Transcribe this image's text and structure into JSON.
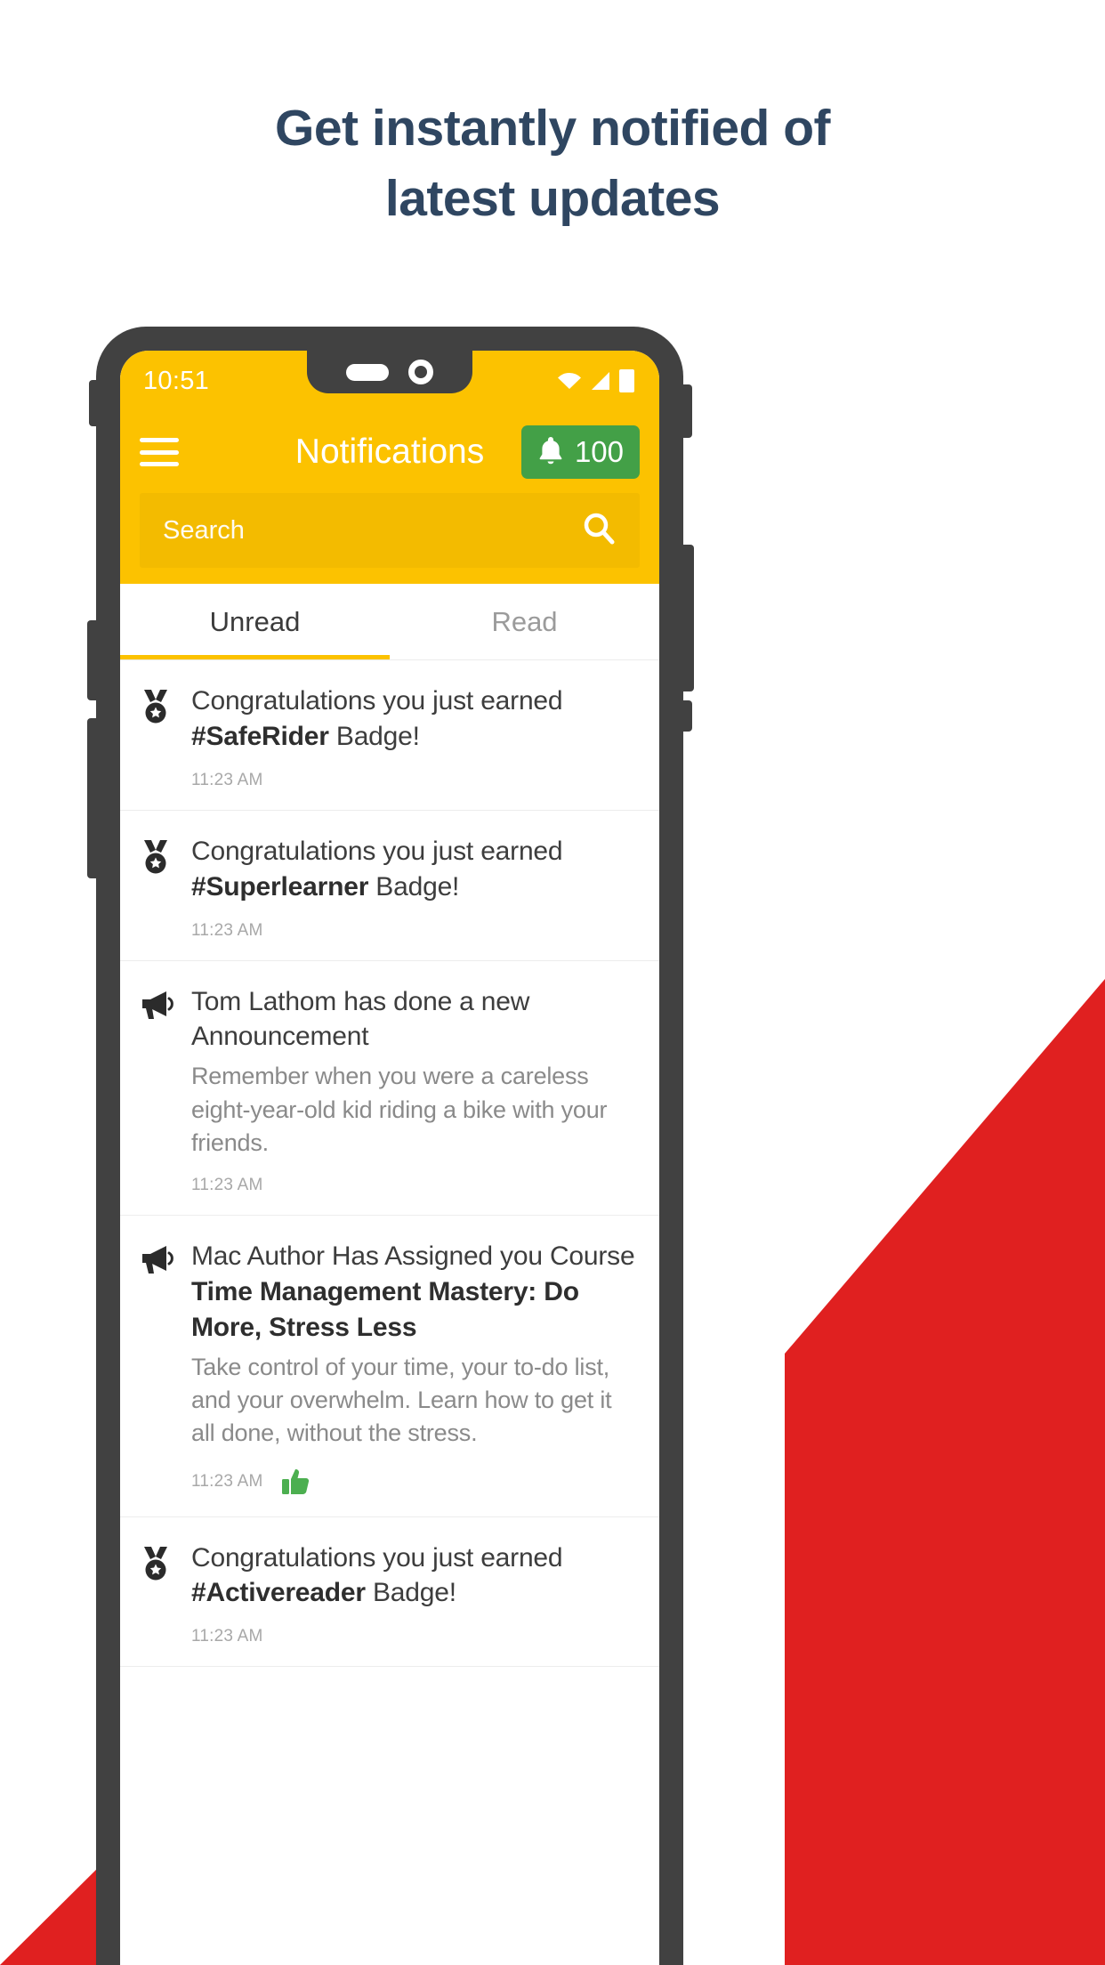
{
  "headline": {
    "line1": "Get instantly notified of",
    "line2": "latest updates",
    "color": "#2f4661"
  },
  "theme": {
    "accent_yellow": "#fcc200",
    "search_yellow": "#f3bb00",
    "badge_green": "#43a047",
    "frame_dark": "#414141",
    "decor_red": "#e02020"
  },
  "status_bar": {
    "time": "10:51",
    "icons": [
      "wifi-icon",
      "signal-icon",
      "battery-icon"
    ]
  },
  "app_bar": {
    "menu_icon": "hamburger-menu-icon",
    "title": "Notifications",
    "badge": {
      "icon": "bell-icon",
      "count": "100"
    }
  },
  "search": {
    "placeholder": "Search",
    "value": "",
    "icon": "search-icon"
  },
  "tabs": [
    {
      "label": "Unread",
      "active": true
    },
    {
      "label": "Read",
      "active": false
    }
  ],
  "notifications": [
    {
      "icon": "medal-icon",
      "title_prefix": "Congratulations you just earned ",
      "title_bold": "#SafeRider",
      "title_suffix": " Badge!",
      "desc": "",
      "time": "11:23 AM",
      "reaction": ""
    },
    {
      "icon": "medal-icon",
      "title_prefix": "Congratulations you just earned ",
      "title_bold": "#Superlearner",
      "title_suffix": " Badge!",
      "desc": "",
      "time": "11:23 AM",
      "reaction": ""
    },
    {
      "icon": "megaphone-icon",
      "title_prefix": "Tom Lathom has done a new Announcement",
      "title_bold": "",
      "title_suffix": "",
      "desc": "Remember when you were a careless eight-year-old kid riding a bike with your friends.",
      "time": "11:23 AM",
      "reaction": ""
    },
    {
      "icon": "megaphone-icon",
      "title_prefix": "Mac Author Has Assigned you Course ",
      "title_bold": "Time Management Mastery: Do More, Stress Less",
      "title_suffix": "",
      "desc": "Take control of your time, your to-do list, and your overwhelm. Learn how to get it all done, without the stress.",
      "time": "11:23 AM",
      "reaction": "thumbs-up-icon"
    },
    {
      "icon": "medal-icon",
      "title_prefix": "Congratulations you just earned ",
      "title_bold": "#Activereader",
      "title_suffix": " Badge!",
      "desc": "",
      "time": "11:23 AM",
      "reaction": ""
    }
  ]
}
